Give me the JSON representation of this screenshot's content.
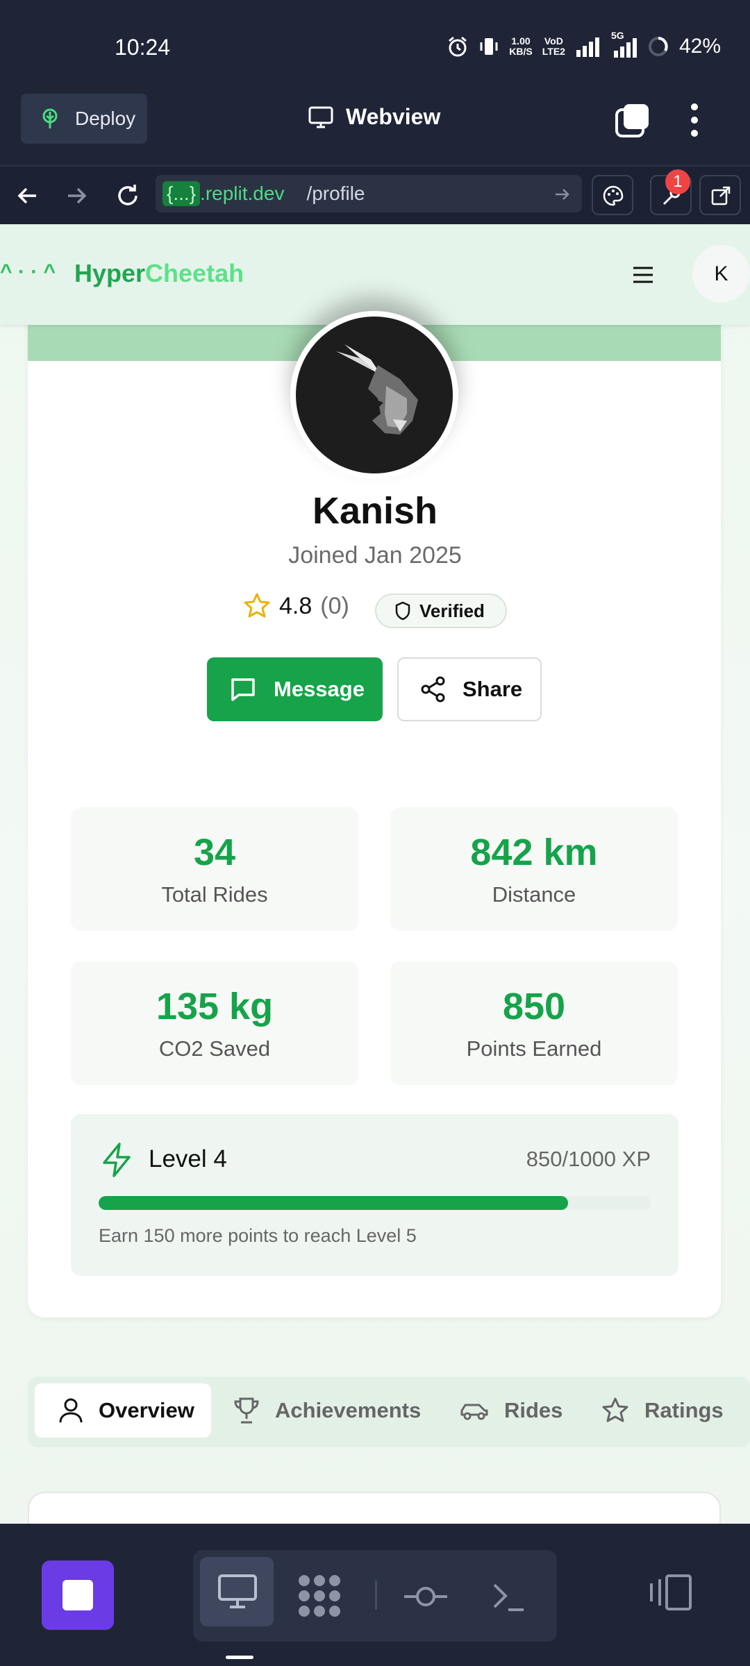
{
  "status": {
    "time": "10:24",
    "net_speed_top": "1.00",
    "net_speed_bottom": "KB/S",
    "volte_top": "VoD",
    "volte_bottom": "LTE2",
    "net_type": "5G",
    "battery": "42%"
  },
  "replit": {
    "deploy_label": "Deploy",
    "webview_label": "Webview",
    "url_host_badge": "{...}",
    "url_host": ".replit.dev",
    "url_path": "/profile",
    "notification_count": "1"
  },
  "app": {
    "ascii_logo": "^ · · ^",
    "brand_part1": "Hyper",
    "brand_part2": "Cheetah",
    "user_initial": "K"
  },
  "profile": {
    "name": "Kanish",
    "joined": "Joined Jan 2025",
    "rating": "4.8",
    "rating_count": "(0)",
    "verified_label": "Verified",
    "message_label": "Message",
    "share_label": "Share"
  },
  "stats": [
    {
      "value": "34",
      "label": "Total Rides"
    },
    {
      "value": "842 km",
      "label": "Distance"
    },
    {
      "value": "135 kg",
      "label": "CO2 Saved"
    },
    {
      "value": "850",
      "label": "Points Earned"
    }
  ],
  "level": {
    "title": "Level 4",
    "xp": "850/1000 XP",
    "progress": 0.85,
    "note": "Earn 150 more points to reach Level 5"
  },
  "tabs": [
    {
      "label": "Overview",
      "icon": "user-icon"
    },
    {
      "label": "Achievements",
      "icon": "trophy-icon"
    },
    {
      "label": "Rides",
      "icon": "car-icon"
    },
    {
      "label": "Ratings",
      "icon": "star-icon"
    }
  ],
  "colors": {
    "accent": "#16a34a",
    "replit_bg": "#1f2537",
    "stop_button": "#6b3be6",
    "badge_red": "#ef4444"
  }
}
